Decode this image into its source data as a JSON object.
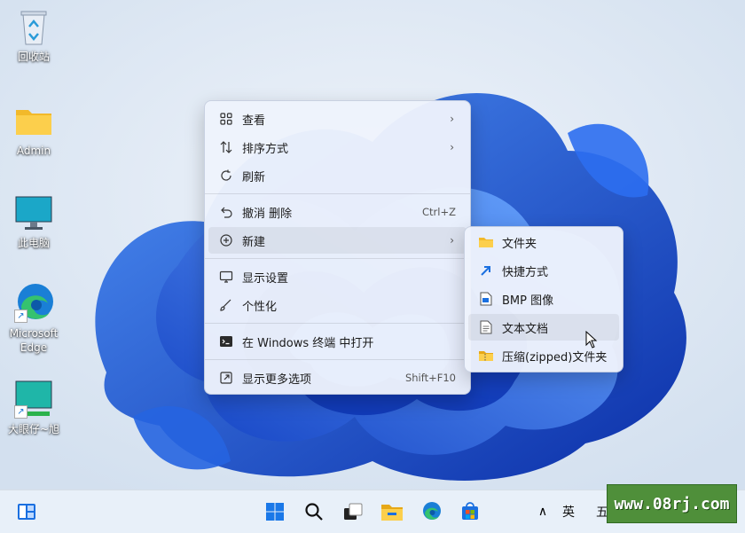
{
  "desktop": {
    "icons": [
      {
        "label": "回收站",
        "icon": "recycle-bin-icon"
      },
      {
        "label": "Admin",
        "icon": "folder-icon"
      },
      {
        "label": "此电脑",
        "icon": "monitor-icon"
      },
      {
        "label": "Microsoft Edge",
        "icon": "edge-icon"
      },
      {
        "label": "大眼仔~旭",
        "icon": "monitor-shortcut-icon"
      }
    ]
  },
  "context_menu": {
    "items": [
      {
        "label": "查看",
        "icon": "view-grid-icon",
        "submenu": true
      },
      {
        "label": "排序方式",
        "icon": "sort-icon",
        "submenu": true
      },
      {
        "label": "刷新",
        "icon": "refresh-icon"
      },
      {
        "label": "撤消 删除",
        "icon": "undo-icon",
        "shortcut": "Ctrl+Z"
      },
      {
        "label": "新建",
        "icon": "new-plus-icon",
        "submenu": true
      },
      {
        "label": "显示设置",
        "icon": "display-settings-icon"
      },
      {
        "label": "个性化",
        "icon": "brush-icon"
      },
      {
        "label": "在 Windows 终端 中打开",
        "icon": "terminal-icon"
      },
      {
        "label": "显示更多选项",
        "icon": "more-options-icon",
        "shortcut": "Shift+F10"
      }
    ]
  },
  "new_submenu": {
    "items": [
      {
        "label": "文件夹",
        "icon": "folder-icon"
      },
      {
        "label": "快捷方式",
        "icon": "shortcut-icon"
      },
      {
        "label": "BMP 图像",
        "icon": "bmp-image-icon"
      },
      {
        "label": "文本文档",
        "icon": "text-document-icon"
      },
      {
        "label": "压缩(zipped)文件夹",
        "icon": "zip-folder-icon"
      }
    ]
  },
  "taskbar": {
    "tray_ime": "英",
    "tray_extra": "五"
  },
  "watermark": {
    "text": "www.08rj.com"
  },
  "colors": {
    "accent": "#1a6fe0",
    "wallpaper_bg": "#dfe9f5",
    "bloom": "#1f56d8"
  }
}
